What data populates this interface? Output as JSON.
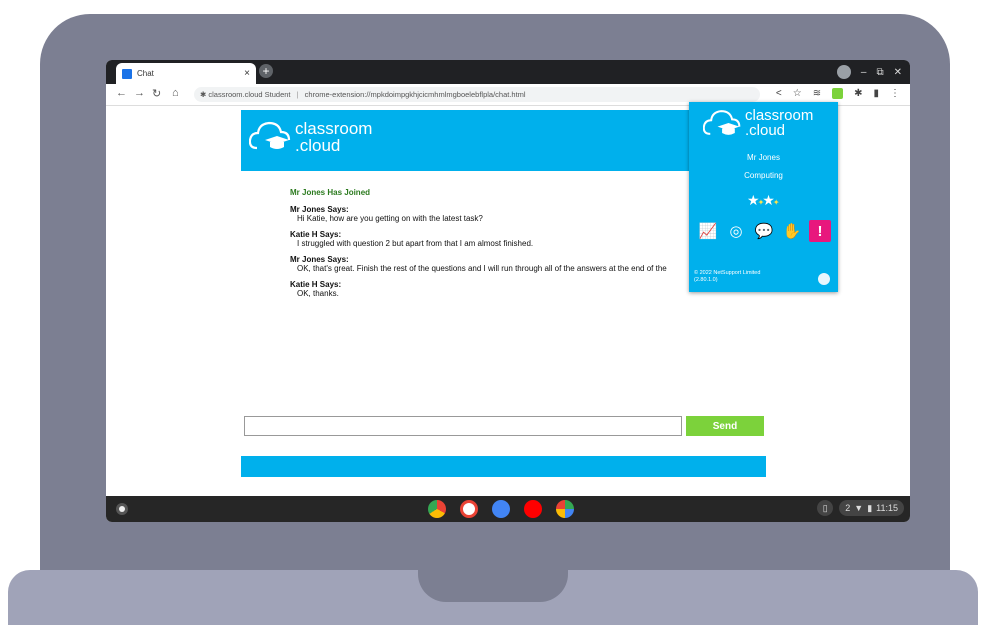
{
  "browser": {
    "tab_title": "Chat",
    "tab_close": "×",
    "new_tab": "+",
    "site_label": "classroom.cloud Student",
    "url": "chrome-extension://mpkdoimpgkhjcicmhmlmgboelebflpla/chat.html",
    "window_controls": [
      "⌄",
      "–",
      "⧉",
      "✕"
    ]
  },
  "page": {
    "logo_line1": "classroom",
    "logo_line2": ".cloud",
    "joined": "Mr Jones Has Joined",
    "messages": [
      {
        "sender": "Mr Jones Says:",
        "text": "Hi Katie, how are you getting on with the latest task?"
      },
      {
        "sender": "Katie H Says:",
        "text": "I struggled with question 2 but apart from that I am almost finished."
      },
      {
        "sender": "Mr Jones Says:",
        "text": "OK, that's great. Finish the rest of the questions and I will run through all of the answers at the end of the"
      },
      {
        "sender": "Katie H Says:",
        "text": "OK, thanks."
      }
    ],
    "send_label": "Send",
    "input_value": ""
  },
  "popup": {
    "logo_line1": "classroom",
    "logo_line2": ".cloud",
    "teacher": "Mr Jones",
    "class_name": "Computing",
    "copyright": "© 2022 NetSupport Limited",
    "version": "(2.80.1.0)",
    "icons": [
      "trend-icon",
      "globe-icon",
      "chat-icon",
      "hand-icon",
      "alert-icon"
    ]
  },
  "shelf": {
    "time": "11:15",
    "notification_count": "2",
    "apps": [
      "chrome-icon",
      "gmail-icon",
      "docs-icon",
      "youtube-icon",
      "play-store-icon"
    ]
  },
  "colors": {
    "brand_blue": "#00b0ec",
    "send_green": "#7cd23b",
    "joined_green": "#2b7a1e",
    "alert_pink": "#e8177d"
  }
}
